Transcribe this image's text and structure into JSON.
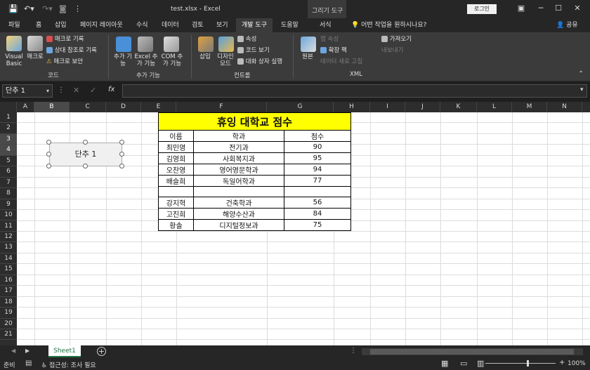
{
  "titlebar": {
    "file_title": "test.xlsx  -  Excel",
    "context_group": "그리기 도구",
    "login": "로그인",
    "minimize": "─",
    "restore": "☐",
    "close": "✕"
  },
  "tabs": [
    {
      "label": "파일"
    },
    {
      "label": "홈"
    },
    {
      "label": "삽입"
    },
    {
      "label": "페이지 레이아웃"
    },
    {
      "label": "수식"
    },
    {
      "label": "데이터"
    },
    {
      "label": "검토"
    },
    {
      "label": "보기"
    },
    {
      "label": "개발 도구"
    },
    {
      "label": "도움말"
    },
    {
      "label": "서식"
    }
  ],
  "tell_me": "어떤 작업을 원하시나요?",
  "share": "공유",
  "ribbon": {
    "code": {
      "visual_basic": "Visual Basic",
      "macro": "매크로",
      "record_macro": "매크로 기록",
      "relative_ref": "상대 참조로 기록",
      "macro_security": "매크로 보안",
      "label": "코드"
    },
    "addins": {
      "addins": "추가 기능",
      "excel_addins": "Excel 추가 기능",
      "com_addins": "COM 추가 기능",
      "label": "추가 기능"
    },
    "controls": {
      "insert": "삽입",
      "design_mode": "디자인 모드",
      "properties": "속성",
      "view_code": "코드 보기",
      "run_dialog": "대화 상자 실행",
      "label": "컨트롤"
    },
    "xml": {
      "source": "원본",
      "map_properties": "맵 속성",
      "expansion_packs": "확장 팩",
      "refresh_data": "데이터 새로 고침",
      "import": "가져오기",
      "export": "내보내기",
      "label": "XML"
    }
  },
  "formula_bar": {
    "name_box": "단추 1",
    "fx": "fx",
    "value": ""
  },
  "columns": [
    "A",
    "B",
    "C",
    "D",
    "E",
    "F",
    "G",
    "H",
    "I",
    "J",
    "K",
    "L",
    "M",
    "N"
  ],
  "selected_column": "B",
  "rows": [
    "1",
    "2",
    "3",
    "4",
    "5",
    "6",
    "7",
    "8",
    "9",
    "10",
    "11",
    "12",
    "13",
    "14",
    "15",
    "16",
    "17",
    "18",
    "19",
    "20",
    "21"
  ],
  "selected_rows": [
    "3",
    "4"
  ],
  "table": {
    "title": "휴잉 대학교 점수",
    "headers": [
      "이름",
      "학과",
      "점수"
    ],
    "rows": [
      [
        "최민영",
        "전기과",
        "90"
      ],
      [
        "김영희",
        "사회복지과",
        "95"
      ],
      [
        "오찬영",
        "영어영문학과",
        "94"
      ],
      [
        "배슬희",
        "독일어학과",
        "77"
      ],
      [
        "",
        "",
        ""
      ],
      [
        "강지혁",
        "건축학과",
        "56"
      ],
      [
        "고진희",
        "해양수산과",
        "84"
      ],
      [
        "황솔",
        "디지털정보과",
        "75"
      ]
    ]
  },
  "form_button": {
    "label": "단추 1"
  },
  "sheets": {
    "active": "Sheet1"
  },
  "status": {
    "ready": "준비",
    "accessibility": "접근성: 조사 필요",
    "zoom": "100%"
  },
  "colors": {
    "accent": "#217346",
    "title_fill": "#ffff00",
    "dark_bg": "#262626"
  }
}
